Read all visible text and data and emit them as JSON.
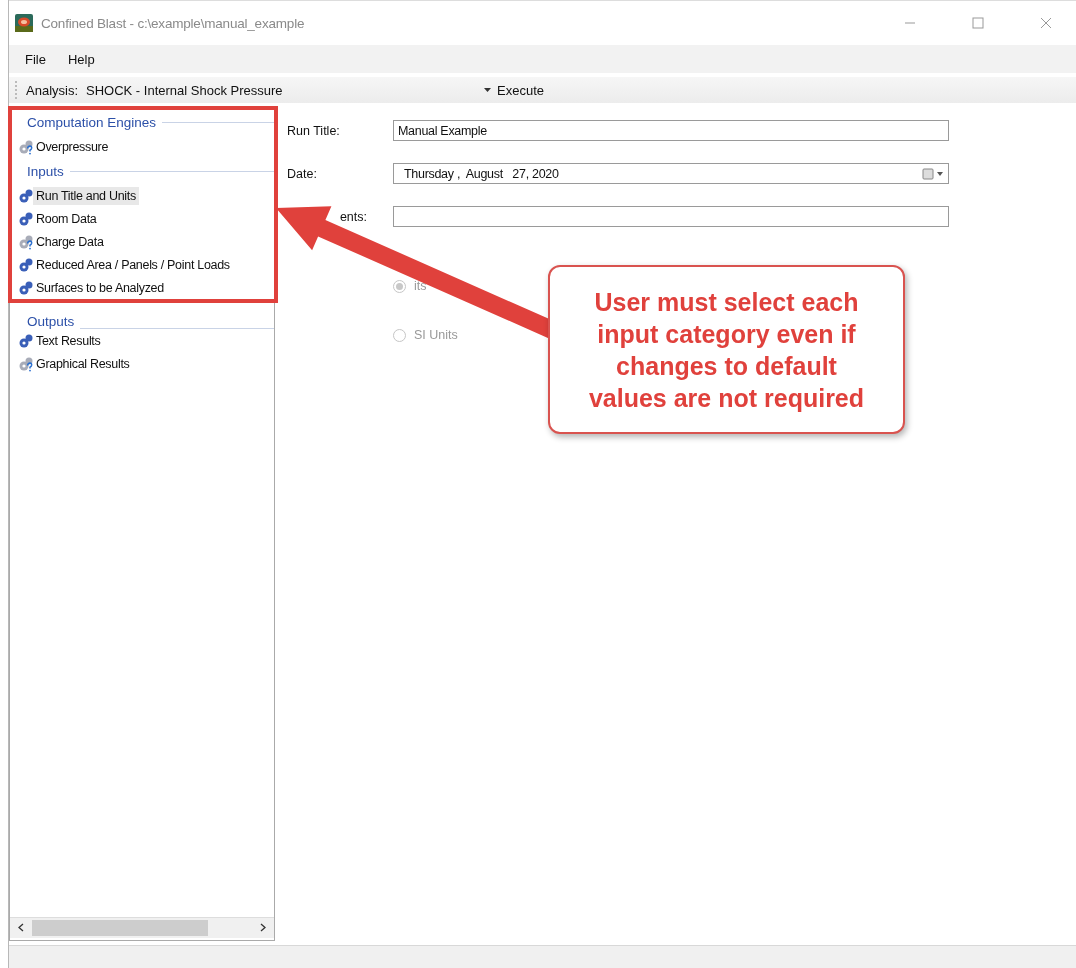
{
  "window": {
    "title": "Confined Blast - c:\\example\\manual_example"
  },
  "menu": [
    "File",
    "Help"
  ],
  "toolbar": {
    "analysis_label": "Analysis:",
    "analysis_value": "SHOCK - Internal Shock Pressure",
    "execute": "Execute"
  },
  "sidebar": {
    "sections": [
      {
        "heading": "Computation Engines",
        "items": [
          {
            "label": "Overpressure",
            "configured": false,
            "selected": false
          }
        ]
      },
      {
        "heading": "Inputs",
        "items": [
          {
            "label": "Run Title and Units",
            "configured": true,
            "selected": true
          },
          {
            "label": "Room Data",
            "configured": true,
            "selected": false
          },
          {
            "label": "Charge Data",
            "configured": false,
            "selected": false
          },
          {
            "label": "Reduced Area / Panels / Point Loads",
            "configured": true,
            "selected": false
          },
          {
            "label": "Surfaces to be Analyzed",
            "configured": true,
            "selected": false
          }
        ]
      },
      {
        "heading": "Outputs",
        "items": [
          {
            "label": "Text Results",
            "configured": true,
            "selected": false
          },
          {
            "label": "Graphical Results",
            "configured": false,
            "selected": false
          }
        ]
      }
    ]
  },
  "form": {
    "run_title_label": "Run Title:",
    "run_title": "Manual Example",
    "date_label": "Date:",
    "date": "Thursday ,  August   27, 2020",
    "comments_label": "ents:",
    "units": [
      {
        "label": "its",
        "selected": true
      },
      {
        "label": "SI Units",
        "selected": false
      }
    ]
  },
  "callout": {
    "text": "User must select each input category even if changes to default values are not required"
  }
}
